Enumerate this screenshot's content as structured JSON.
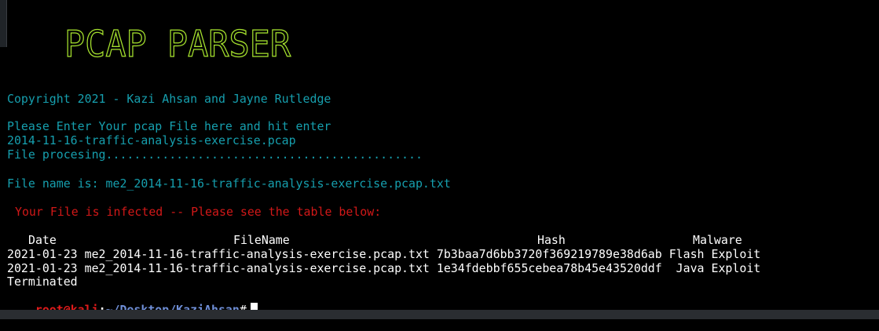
{
  "banner": {
    "text": "PCAP PARSER",
    "color": "#a6e22e"
  },
  "copyright": "Copyright 2021 - Kazi Ahsan and Jayne Rutledge",
  "prompt_text": "Please Enter Your pcap File here and hit enter",
  "input_file": "2014-11-16-traffic-analysis-exercise.pcap",
  "processing": "File procesing.............................................",
  "file_name_line": "File name is: me2_2014-11-16-traffic-analysis-exercise.pcap.txt",
  "infected_msg": "Your File is infected -- Please see the table below:",
  "table": {
    "headers": {
      "date": "Date",
      "filename": "FileName",
      "hash": "Hash",
      "malware": "Malware"
    },
    "rows": [
      "2021-01-23 me2_2014-11-16-traffic-analysis-exercise.pcap.txt 7b3baa7d6bb3720f369219789e38d6ab Flash Exploit",
      "2021-01-23 me2_2014-11-16-traffic-analysis-exercise.pcap.txt 1e34fdebbf655cebea78b45e43520ddf  Java Exploit"
    ]
  },
  "terminated": "Terminated",
  "shell_prompt": {
    "user_host": "root@kali",
    "colon": ":",
    "path": "~/Desktop/KaziAhsan",
    "symbol": "#"
  },
  "colors": {
    "background": "#000000",
    "cyan_text": "#169fae",
    "red_text": "#d21818",
    "prompt_user": "#e01b1b",
    "prompt_path": "#6f8fd8"
  }
}
